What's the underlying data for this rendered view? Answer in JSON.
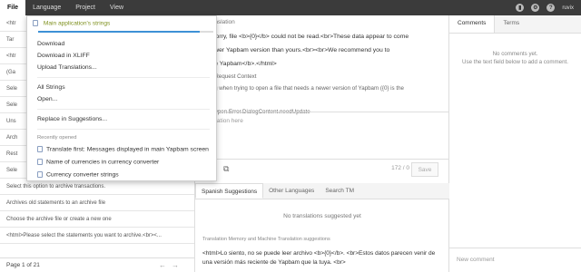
{
  "menu": {
    "items": [
      "File",
      "Language",
      "Project",
      "View"
    ],
    "active": "File"
  },
  "topbar": {
    "user": "ruvix",
    "icons": [
      "chart-icon",
      "gear-icon",
      "help-icon"
    ]
  },
  "left_panel": {
    "rows": [
      "<htr",
      "Tar",
      "<htr",
      "(Ga",
      "Sele",
      "Sele",
      "Uns",
      "Arch",
      "Rest",
      "Sele",
      "Select this option to archive transactions.",
      "Archives old statements to an archive file",
      "Choose the archive file or create a new one",
      "<html>Please select the statements you want to archive.<br><..."
    ],
    "page_text": "Page 1 of 21"
  },
  "center_panel": {
    "header": "r Translation",
    "source_text_1": "br>Sorry, file <b>{0}</b> could not be read.<br>These data appear to come",
    "source_text_2": "a newer Yapbam version than yours.<br><br>We recommend you to",
    "source_text_3": "pdate Yapbam</b>.</html>",
    "context_label": "ext : Request Context",
    "context_desc": "dialog when trying to open a file that needs a newer version of Yapbam ({0} is the",
    "context_desc2": "me).",
    "context_key": "enu.Open.Error.DialogContent.needUpdate",
    "translation_placeholder": "translation here",
    "counter": "172 / 0",
    "save_label": "Save",
    "tabs": [
      "Spanish Suggestions",
      "Other Languages",
      "Search TM"
    ],
    "active_tab": "Spanish Suggestions",
    "no_suggestions": "No translations suggested yet",
    "tm_title": "Translation Memory and Machine Translation suggestions",
    "tm_text": "<html>Lo siento, no se puede leer archivo <b>{0}</b>. <br>Estos datos parecen venir de una versión más reciente de Yapbam que la tuya. <br>"
  },
  "right_panel": {
    "tabs": [
      "Comments",
      "Terms"
    ],
    "info_1": "No comments yet.",
    "info_2": "Use the text field below to add a comment.",
    "new_comment": "New comment"
  },
  "dropdown": {
    "header": "Main application's strings",
    "progress": 0.92,
    "items": [
      "Download",
      "Download in XLIFF",
      "Upload Translations..."
    ],
    "items2": [
      "All Strings",
      "Open..."
    ],
    "items3": [
      "Replace in Suggestions..."
    ],
    "recent_label": "Recently opened",
    "recent": [
      "Translate first: Messages displayed in main Yapbam screen",
      "Name of currencies in currency converter",
      "Currency converter strings"
    ]
  }
}
